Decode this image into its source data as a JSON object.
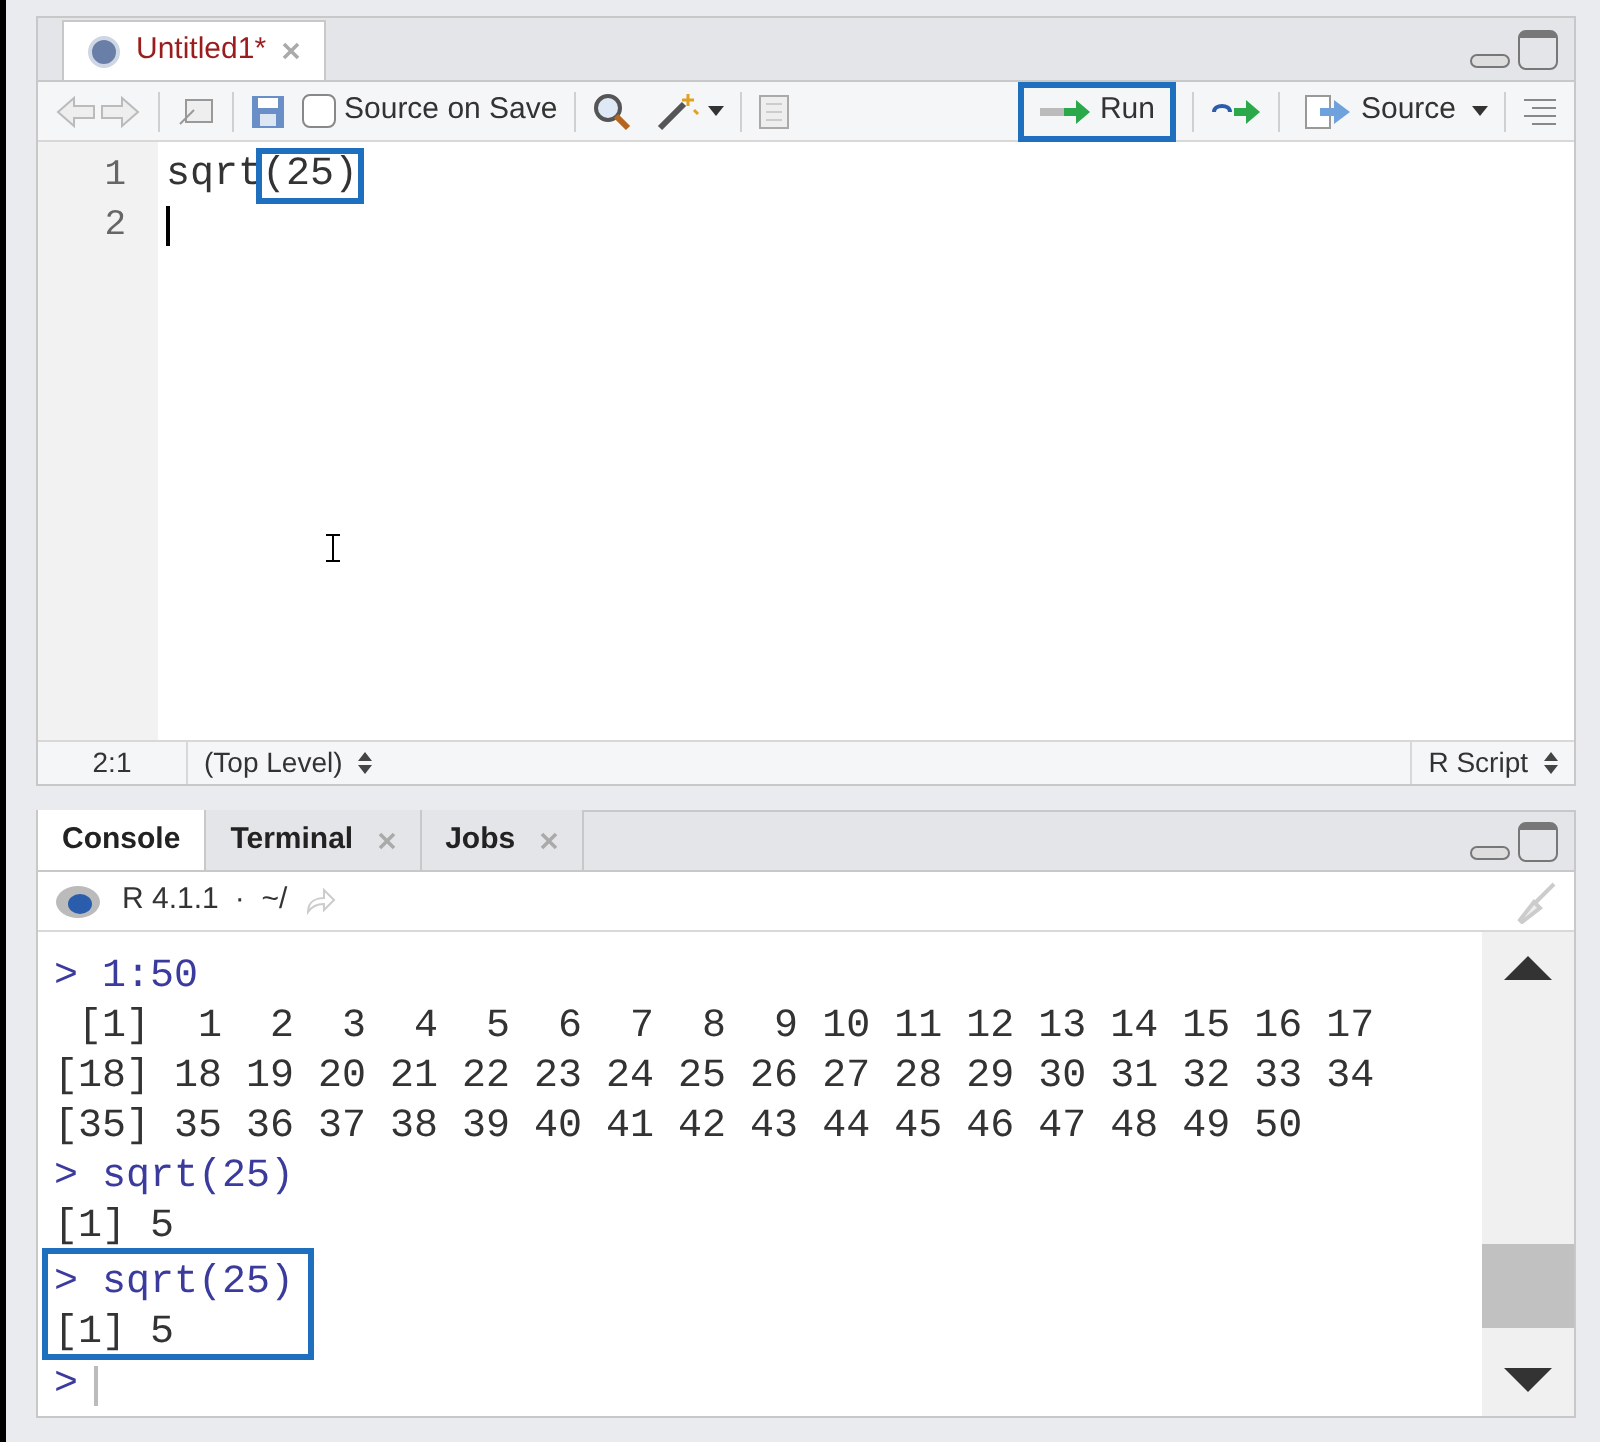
{
  "editor_tabs": [
    {
      "label": "Untitled1*",
      "selected": true,
      "modified": true
    }
  ],
  "toolbar": {
    "source_on_save": {
      "label": "Source on Save",
      "checked": false
    },
    "run_button": {
      "label": "Run",
      "highlighted": true
    },
    "source_button": {
      "label": "Source"
    }
  },
  "code_lines": [
    {
      "number": "1",
      "segments": [
        {
          "text": "sqrt",
          "highlighted": false
        },
        {
          "text": "(25)",
          "highlighted": true
        }
      ]
    },
    {
      "number": "2"
    }
  ],
  "status_bar": {
    "position": "2:1",
    "scope": "(Top Level)",
    "file_type": "R Script"
  },
  "console_tabs": [
    {
      "label": "Console",
      "selected": true,
      "closable": false
    },
    {
      "label": "Terminal",
      "selected": false,
      "closable": true
    },
    {
      "label": "Jobs",
      "selected": false,
      "closable": true
    }
  ],
  "console_header": {
    "version": "R 4.1.1",
    "path": "·  ~/"
  },
  "console_blocks": [
    {
      "highlighted": false,
      "lines": [
        {
          "kind": "input",
          "text": "> 1:50"
        },
        {
          "kind": "output",
          "text": " [1]  1  2  3  4  5  6  7  8  9 10 11 12 13 14 15 16 17"
        },
        {
          "kind": "output",
          "text": "[18] 18 19 20 21 22 23 24 25 26 27 28 29 30 31 32 33 34"
        },
        {
          "kind": "output",
          "text": "[35] 35 36 37 38 39 40 41 42 43 44 45 46 47 48 49 50"
        },
        {
          "kind": "input",
          "text": "> sqrt(25)"
        },
        {
          "kind": "output",
          "text": "[1] 5"
        }
      ]
    },
    {
      "highlighted": true,
      "lines": [
        {
          "kind": "input",
          "text": "> sqrt(25)"
        },
        {
          "kind": "output",
          "text": "[1] 5"
        }
      ]
    },
    {
      "highlighted": false,
      "lines": [
        {
          "kind": "prompt",
          "text": ">"
        }
      ]
    }
  ]
}
